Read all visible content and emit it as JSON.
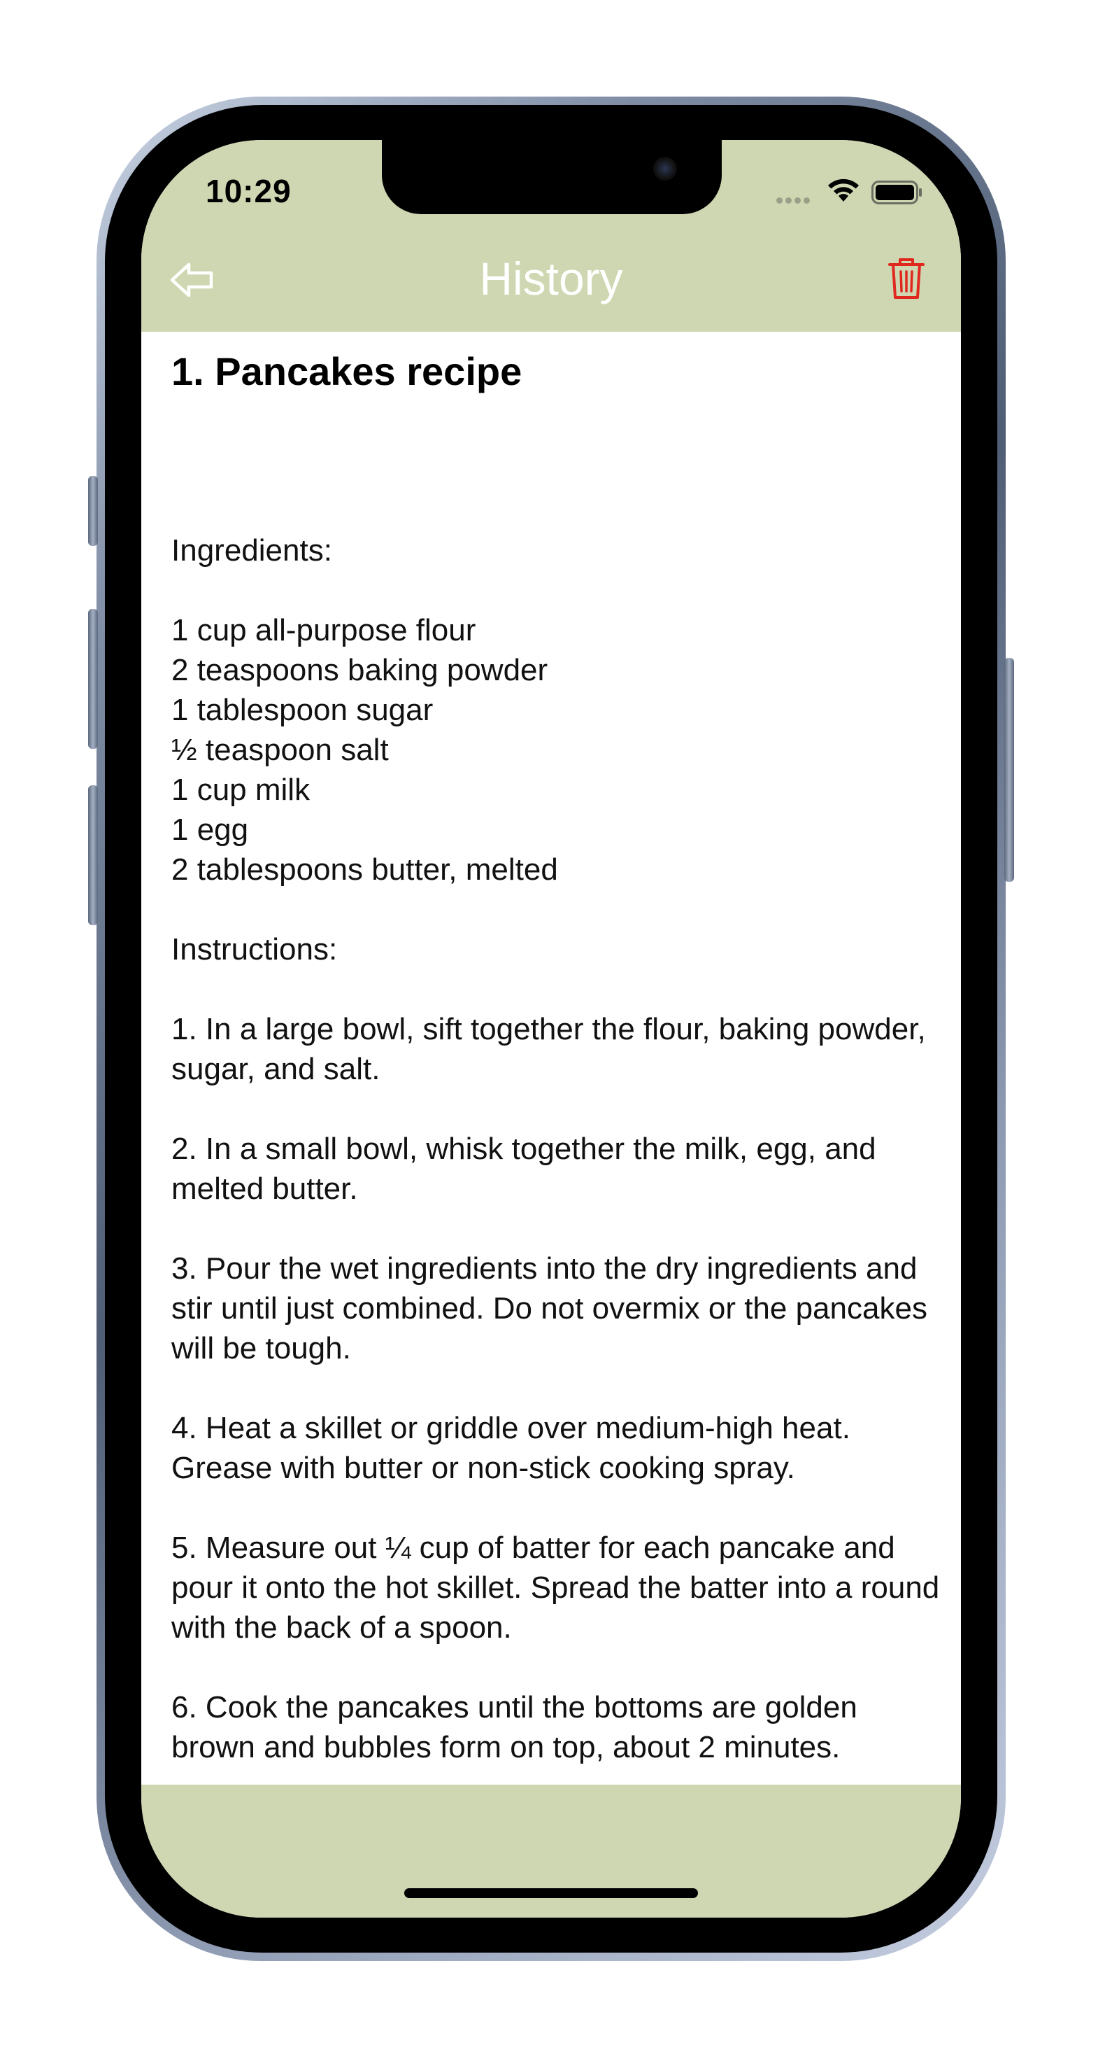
{
  "status_bar": {
    "time": "10:29"
  },
  "nav": {
    "title": "History",
    "back_icon": "back-arrow-icon",
    "trash_icon": "trash-icon"
  },
  "recipe": {
    "title": "1. Pancakes recipe",
    "ingredients_heading": "Ingredients:",
    "ingredients": [
      "1 cup all-purpose flour",
      "2 teaspoons baking powder",
      "1 tablespoon sugar",
      "½ teaspoon salt",
      "1 cup milk",
      "1 egg",
      "2 tablespoons butter, melted"
    ],
    "instructions_heading": "Instructions:",
    "instructions": [
      "1. In a large bowl, sift together the flour, baking powder, sugar, and salt.",
      "2. In a small bowl, whisk together the milk, egg, and melted butter.",
      "3. Pour the wet ingredients into the dry ingredients and stir until just combined. Do not overmix or the pancakes will be tough.",
      "4. Heat a skillet or griddle over medium-high heat. Grease with butter or non-stick cooking spray.",
      "5. Measure out ¼ cup of batter for each pancake and pour it onto the hot skillet. Spread the batter into a round with the back of a spoon.",
      "6. Cook the pancakes until the bottoms are golden brown and bubbles form on top, about 2 minutes."
    ]
  },
  "colors": {
    "bar_background": "#ced7b1",
    "title_text": "#ffffff",
    "trash_red": "#e0281f"
  }
}
